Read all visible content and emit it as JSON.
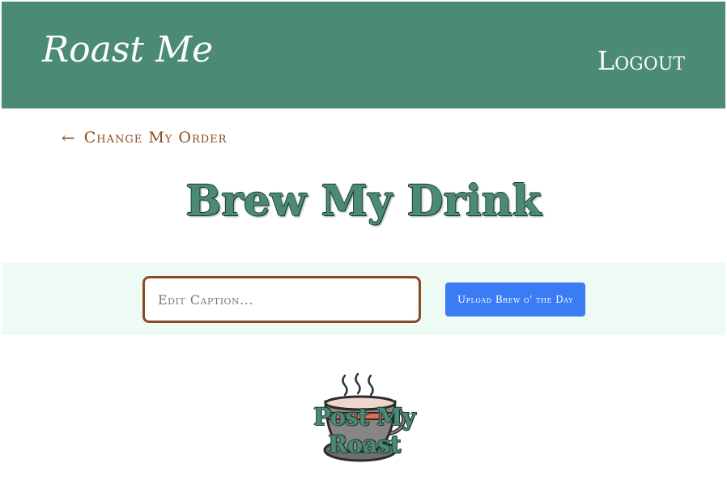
{
  "header": {
    "brand": "Roast Me",
    "logout_label": "Logout"
  },
  "nav": {
    "back_arrow": "←",
    "back_label": "Change My Order"
  },
  "main": {
    "title": "Brew My Drink",
    "caption_input": {
      "value": "",
      "placeholder": "Edit Caption..."
    },
    "upload_button_label": "Upload Brew o' the Day",
    "post_label": "Post My Roast"
  },
  "icons": {
    "post_icon": "coffee-cup-icon",
    "back_icon": "arrow-left-icon"
  },
  "colors": {
    "header_bg": "#4c8a78",
    "accent_brown": "#8a4a22",
    "title_green": "#4c8a78",
    "button_blue": "#3b7cf4",
    "band_bg": "#eefbf4"
  }
}
